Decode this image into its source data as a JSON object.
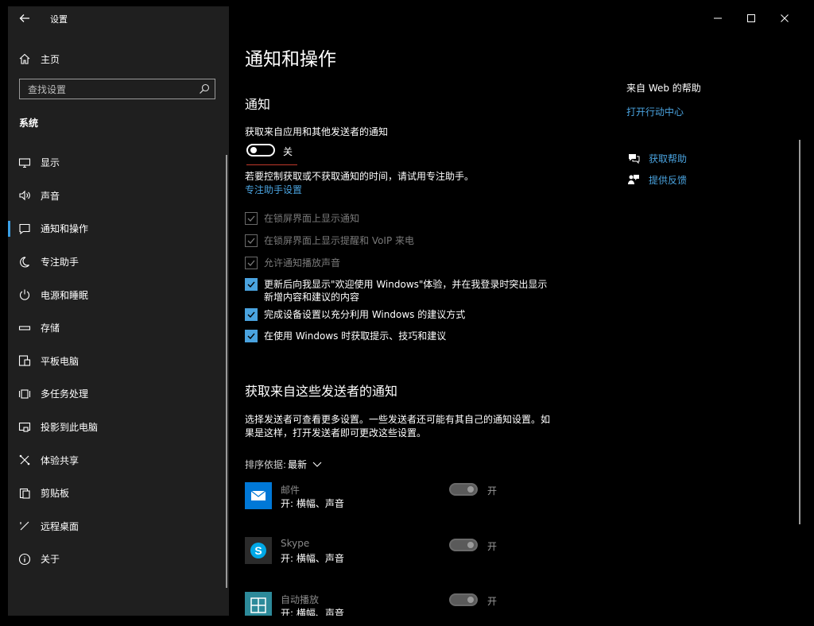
{
  "window": {
    "title": "设置",
    "controls": [
      "minimize",
      "maximize",
      "close"
    ]
  },
  "sidebar": {
    "home_label": "主页",
    "search_placeholder": "查找设置",
    "section_label": "系统",
    "items": [
      {
        "label": "显示",
        "icon": "monitor-icon"
      },
      {
        "label": "声音",
        "icon": "speaker-icon"
      },
      {
        "label": "通知和操作",
        "icon": "notification-icon",
        "active": true
      },
      {
        "label": "专注助手",
        "icon": "moon-icon"
      },
      {
        "label": "电源和睡眠",
        "icon": "power-icon"
      },
      {
        "label": "存储",
        "icon": "storage-icon"
      },
      {
        "label": "平板电脑",
        "icon": "tablet-icon"
      },
      {
        "label": "多任务处理",
        "icon": "multitask-icon"
      },
      {
        "label": "投影到此电脑",
        "icon": "project-icon"
      },
      {
        "label": "体验共享",
        "icon": "share-icon"
      },
      {
        "label": "剪贴板",
        "icon": "clipboard-icon"
      },
      {
        "label": "远程桌面",
        "icon": "remote-desktop-icon"
      },
      {
        "label": "关于",
        "icon": "info-icon"
      }
    ]
  },
  "main": {
    "page_title": "通知和操作",
    "notifications_heading": "通知",
    "get_notifications_label": "获取来自应用和其他发送者的通知",
    "toggle_state": "关",
    "focus_hint": "若要控制获取或不获取通知的时间，请试用专注助手。",
    "focus_link": "专注助手设置",
    "checkboxes": [
      {
        "label": "在锁屏界面上显示通知",
        "checked": true,
        "disabled": true
      },
      {
        "label": "在锁屏界面上显示提醒和 VoIP 来电",
        "checked": true,
        "disabled": true
      },
      {
        "label": "允许通知播放声音",
        "checked": true,
        "disabled": true
      },
      {
        "label": "更新后向我显示\"欢迎使用 Windows\"体验，并在我登录时突出显示",
        "label2": "新增内容和建议的内容",
        "checked": true,
        "disabled": false
      },
      {
        "label": "完成设备设置以充分利用 Windows 的建议方式",
        "checked": true,
        "disabled": false
      },
      {
        "label": "在使用 Windows 时获取提示、技巧和建议",
        "checked": true,
        "disabled": false
      }
    ],
    "senders_heading": "获取来自这些发送者的通知",
    "senders_desc_1": "选择发送者可查看更多设置。一些发送者还可能有其自己的通知设置。如",
    "senders_desc_2": "果是这样，打开发送者即可更改这些设置。",
    "sort_label": "排序依据:",
    "sort_value": "最新",
    "apps": [
      {
        "name": "邮件",
        "sub": "开: 横幅、声音",
        "toggle": "开",
        "icon": "mail-icon"
      },
      {
        "name": "Skype",
        "sub": "开: 横幅、声音",
        "toggle": "开",
        "icon": "skype-icon"
      },
      {
        "name": "自动播放",
        "sub": "开: 横幅、声音",
        "toggle": "开",
        "icon": "autoplay-icon"
      }
    ]
  },
  "right_panel": {
    "title": "来自 Web 的帮助",
    "link": "打开行动中心",
    "get_help": "获取帮助",
    "feedback": "提供反馈"
  },
  "colors": {
    "accent": "#4aa3df",
    "sidebar_bg": "#1f1f1f",
    "main_bg": "#000000"
  }
}
